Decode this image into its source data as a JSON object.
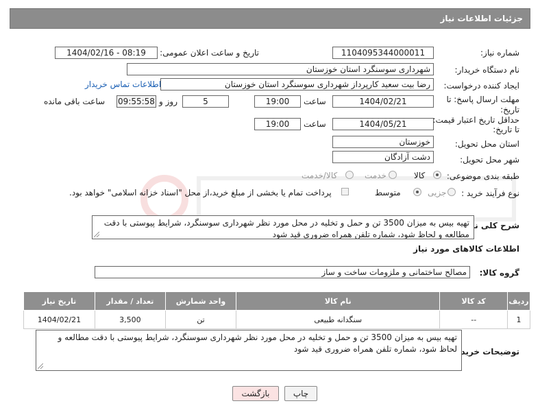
{
  "header": {
    "title": "جزئیات اطلاعات نیاز"
  },
  "form": {
    "need_number_label": "شماره نیاز:",
    "need_number": "1104095344000011",
    "announce_label": "تاریخ و ساعت اعلان عمومی:",
    "announce_value": "1404/02/16 - 08:19",
    "buyer_org_label": "نام دستگاه خریدار:",
    "buyer_org": "شهرداری سوسنگرد استان خوزستان",
    "requester_label": "ایجاد کننده درخواست:",
    "requester": "رضا بیت سعید کارپرداز شهرداری سوسنگرد استان خوزستان",
    "contact_link": "اطلاعات تماس خریدار",
    "deadline_label_1": "مهلت ارسال پاسخ: تا",
    "deadline_label_2": "تاریخ:",
    "deadline_date": "1404/02/21",
    "time_label": "ساعت",
    "deadline_time": "19:00",
    "days_value": "5",
    "days_label": "روز و",
    "remaining_time": "09:55:58",
    "remaining_label": "ساعت باقی مانده",
    "price_label_1": "حداقل تاریخ اعتبار قیمت:",
    "price_label_2": "تا تاریخ:",
    "price_date": "1404/05/21",
    "price_time": "19:00",
    "province_label": "استان محل تحویل:",
    "province": "خوزستان",
    "city_label": "شهر محل تحویل:",
    "city": "دشت آزادگان",
    "category_label": "طبقه بندی موضوعی:",
    "category_options": [
      "کالا",
      "خدمت",
      "کالا/خدمت"
    ],
    "process_label": "نوع فرآیند خرید :",
    "process_options": [
      "جزیی",
      "متوسط"
    ],
    "payment_note": "پرداخت تمام یا بخشی از مبلغ خرید،از محل \"اسناد خزانه اسلامی\" خواهد بود."
  },
  "description": {
    "label": "شرح کلی نیاز:",
    "text": "تهیه بیس به میزان 3500 تن و حمل و تخلیه در محل مورد نظر شهرداری سوسنگرد، شرایط پیوستی با دقت مطالعه و لحاظ شود، شماره تلفن همراه ضروری قید شود"
  },
  "goods": {
    "section_title": "اطلاعات کالاهای مورد نیاز",
    "group_label": "گروه کالا:",
    "group_value": "مصالح ساختمانی و ملزومات ساخت و ساز",
    "columns": [
      "ردیف",
      "کد کالا",
      "نام کالا",
      "واحد شمارش",
      "تعداد / مقدار",
      "تاریخ نیاز"
    ],
    "rows": [
      [
        "1",
        "--",
        "سنگدانه طبیعی",
        "تن",
        "3,500",
        "1404/02/21"
      ]
    ]
  },
  "buyer_notes": {
    "label": "توضیحات خریدار:",
    "text": "تهیه بیس به میزان 3500 تن و حمل و تخلیه در محل مورد نظر شهرداری سوسنگرد، شرایط پیوستی با دقت مطالعه و لحاظ شود، شماره تلفن همراه ضروری قید شود"
  },
  "buttons": {
    "print": "چاپ",
    "back": "بازگشت"
  },
  "colors": {
    "header_bg": "#8c8c8c",
    "link": "#1a5fb4",
    "back_btn_bg": "#fbe3e3"
  }
}
